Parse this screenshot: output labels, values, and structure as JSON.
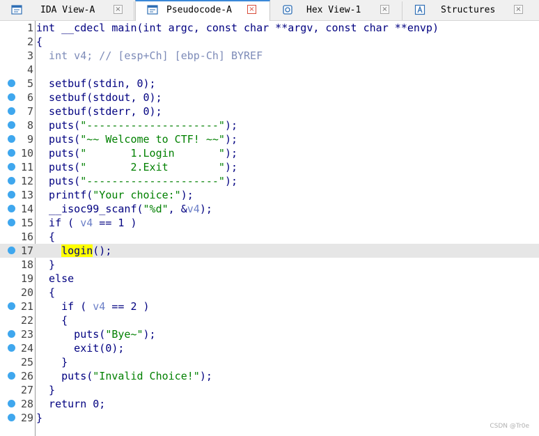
{
  "tabs": [
    {
      "label": "IDA View-A",
      "icon": "ida-view-icon",
      "active": false,
      "close": "×"
    },
    {
      "label": "Pseudocode-A",
      "icon": "pseudocode-icon",
      "active": true,
      "close": "×"
    },
    {
      "label": "Hex View-1",
      "icon": "hex-view-icon",
      "active": false,
      "close": "×"
    },
    {
      "label": "Structures",
      "icon": "structures-icon",
      "active": false,
      "close": "×"
    }
  ],
  "colors": {
    "keyword": "#000080",
    "string": "#008000",
    "variable": "#6b7fc7",
    "comment": "#7d8bb8",
    "breakpoint": "#3fa7ee",
    "highlight": "#ffff00",
    "current_line": "#e6e6e6"
  },
  "current_line": 17,
  "lines": [
    {
      "n": "1",
      "bp": false,
      "tokens": [
        {
          "t": "int __cdecl main(int argc, const char **argv, const char **envp)",
          "k": ""
        }
      ]
    },
    {
      "n": "2",
      "bp": false,
      "tokens": [
        {
          "t": "{",
          "k": ""
        }
      ]
    },
    {
      "n": "3",
      "bp": false,
      "tokens": [
        {
          "t": "  int v4; // [esp+Ch] [ebp-Ch] BYREF",
          "k": "cmt"
        }
      ]
    },
    {
      "n": "4",
      "bp": false,
      "tokens": []
    },
    {
      "n": "5",
      "bp": true,
      "tokens": [
        {
          "t": "  setbuf(stdin, 0);",
          "k": ""
        }
      ]
    },
    {
      "n": "6",
      "bp": true,
      "tokens": [
        {
          "t": "  setbuf(stdout, 0);",
          "k": ""
        }
      ]
    },
    {
      "n": "7",
      "bp": true,
      "tokens": [
        {
          "t": "  setbuf(stderr, 0);",
          "k": ""
        }
      ]
    },
    {
      "n": "8",
      "bp": true,
      "tokens": [
        {
          "t": "  puts(",
          "k": ""
        },
        {
          "t": "\"---------------------\"",
          "k": "str"
        },
        {
          "t": ");",
          "k": ""
        }
      ]
    },
    {
      "n": "9",
      "bp": true,
      "tokens": [
        {
          "t": "  puts(",
          "k": ""
        },
        {
          "t": "\"~~ Welcome to CTF! ~~\"",
          "k": "str"
        },
        {
          "t": ");",
          "k": ""
        }
      ]
    },
    {
      "n": "10",
      "bp": true,
      "tokens": [
        {
          "t": "  puts(",
          "k": ""
        },
        {
          "t": "\"       1.Login       \"",
          "k": "str"
        },
        {
          "t": ");",
          "k": ""
        }
      ]
    },
    {
      "n": "11",
      "bp": true,
      "tokens": [
        {
          "t": "  puts(",
          "k": ""
        },
        {
          "t": "\"       2.Exit        \"",
          "k": "str"
        },
        {
          "t": ");",
          "k": ""
        }
      ]
    },
    {
      "n": "12",
      "bp": true,
      "tokens": [
        {
          "t": "  puts(",
          "k": ""
        },
        {
          "t": "\"---------------------\"",
          "k": "str"
        },
        {
          "t": ");",
          "k": ""
        }
      ]
    },
    {
      "n": "13",
      "bp": true,
      "tokens": [
        {
          "t": "  printf(",
          "k": ""
        },
        {
          "t": "\"Your choice:\"",
          "k": "str"
        },
        {
          "t": ");",
          "k": ""
        }
      ]
    },
    {
      "n": "14",
      "bp": true,
      "tokens": [
        {
          "t": "  __isoc99_scanf(",
          "k": ""
        },
        {
          "t": "\"%d\"",
          "k": "str"
        },
        {
          "t": ", &",
          "k": ""
        },
        {
          "t": "v4",
          "k": "var"
        },
        {
          "t": ");",
          "k": ""
        }
      ]
    },
    {
      "n": "15",
      "bp": true,
      "tokens": [
        {
          "t": "  if ( ",
          "k": ""
        },
        {
          "t": "v4",
          "k": "var"
        },
        {
          "t": " == 1 )",
          "k": ""
        }
      ]
    },
    {
      "n": "16",
      "bp": false,
      "tokens": [
        {
          "t": "  {",
          "k": ""
        }
      ]
    },
    {
      "n": "17",
      "bp": true,
      "tokens": [
        {
          "t": "    ",
          "k": ""
        },
        {
          "t": "login",
          "k": "hl"
        },
        {
          "t": "();",
          "k": ""
        }
      ]
    },
    {
      "n": "18",
      "bp": false,
      "tokens": [
        {
          "t": "  }",
          "k": ""
        }
      ]
    },
    {
      "n": "19",
      "bp": false,
      "tokens": [
        {
          "t": "  else",
          "k": ""
        }
      ]
    },
    {
      "n": "20",
      "bp": false,
      "tokens": [
        {
          "t": "  {",
          "k": ""
        }
      ]
    },
    {
      "n": "21",
      "bp": true,
      "tokens": [
        {
          "t": "    if ( ",
          "k": ""
        },
        {
          "t": "v4",
          "k": "var"
        },
        {
          "t": " == 2 )",
          "k": ""
        }
      ]
    },
    {
      "n": "22",
      "bp": false,
      "tokens": [
        {
          "t": "    {",
          "k": ""
        }
      ]
    },
    {
      "n": "23",
      "bp": true,
      "tokens": [
        {
          "t": "      puts(",
          "k": ""
        },
        {
          "t": "\"Bye~\"",
          "k": "str"
        },
        {
          "t": ");",
          "k": ""
        }
      ]
    },
    {
      "n": "24",
      "bp": true,
      "tokens": [
        {
          "t": "      exit(0);",
          "k": ""
        }
      ]
    },
    {
      "n": "25",
      "bp": false,
      "tokens": [
        {
          "t": "    }",
          "k": ""
        }
      ]
    },
    {
      "n": "26",
      "bp": true,
      "tokens": [
        {
          "t": "    puts(",
          "k": ""
        },
        {
          "t": "\"Invalid Choice!\"",
          "k": "str"
        },
        {
          "t": ");",
          "k": ""
        }
      ]
    },
    {
      "n": "27",
      "bp": false,
      "tokens": [
        {
          "t": "  }",
          "k": ""
        }
      ]
    },
    {
      "n": "28",
      "bp": true,
      "tokens": [
        {
          "t": "  return 0;",
          "k": ""
        }
      ]
    },
    {
      "n": "29",
      "bp": true,
      "tokens": [
        {
          "t": "}",
          "k": ""
        }
      ]
    }
  ],
  "watermark": "CSDN @Tr0e"
}
